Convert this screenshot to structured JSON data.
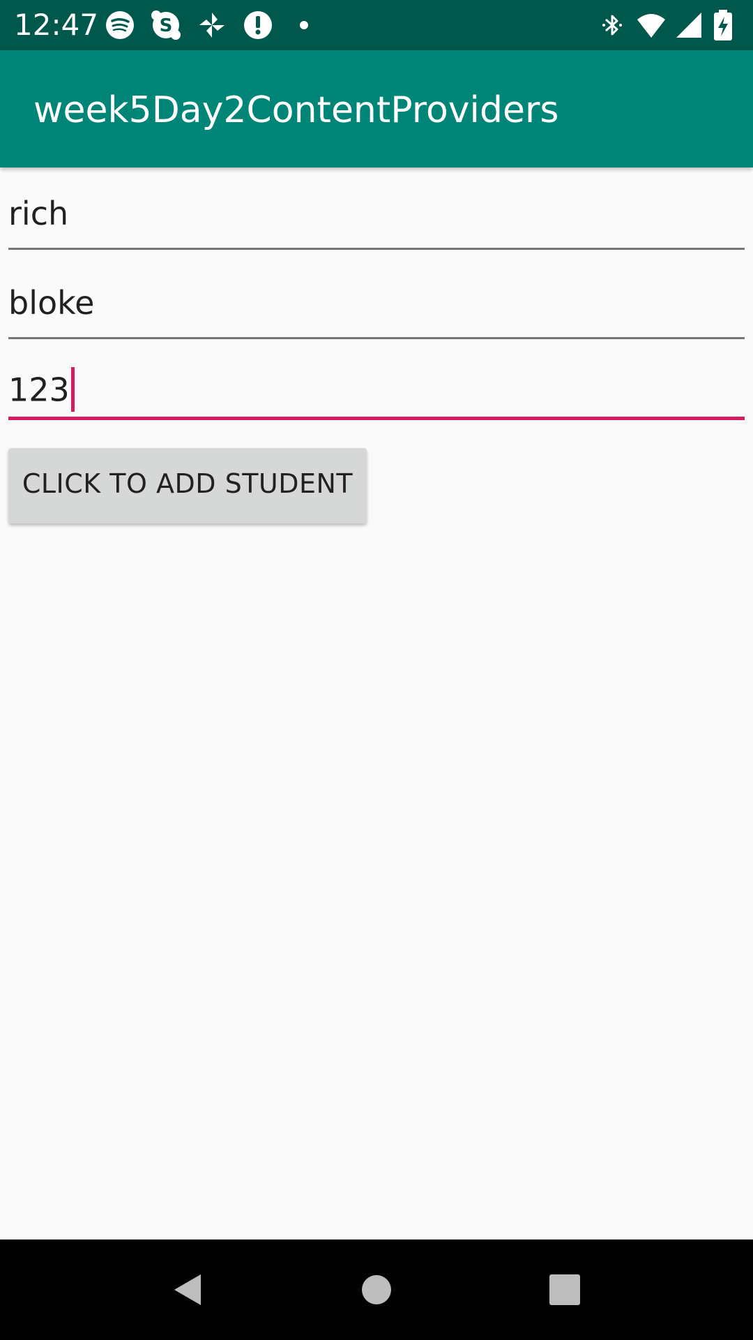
{
  "status_bar": {
    "time": "12:47",
    "background": "#00574b",
    "left_icons": [
      "spotify-icon",
      "skype-icon",
      "pinwheel-icon",
      "alert-icon",
      "dot-icon"
    ],
    "right_icons": [
      "bluetooth-icon",
      "wifi-icon",
      "signal-icon",
      "battery-charging-icon"
    ]
  },
  "app_bar": {
    "title": "week5Day2ContentProviders",
    "background": "#008577"
  },
  "form": {
    "field1_value": "rich",
    "field2_value": "bloke",
    "field3_value": "123",
    "accent": "#d81b60"
  },
  "button": {
    "label": "CLICK TO ADD STUDENT"
  },
  "nav_bar": {
    "icons": [
      "back-icon",
      "home-icon",
      "recents-icon"
    ]
  }
}
